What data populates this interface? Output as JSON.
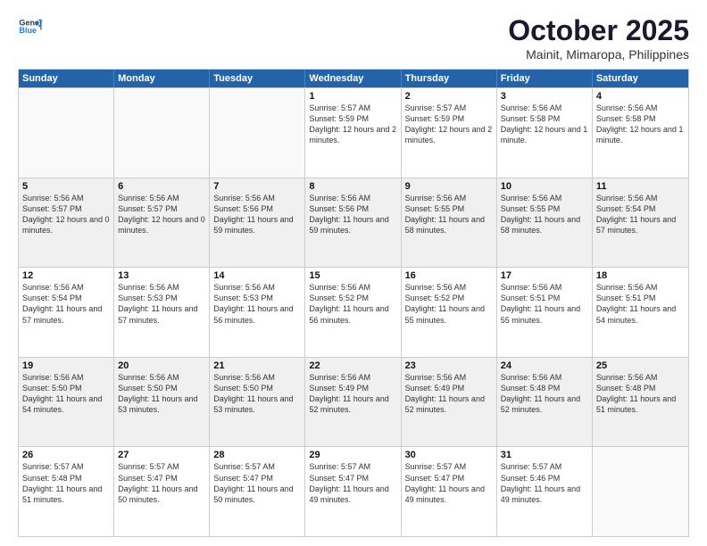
{
  "header": {
    "logo_line1": "General",
    "logo_line2": "Blue",
    "month": "October 2025",
    "location": "Mainit, Mimaropa, Philippines"
  },
  "weekdays": [
    "Sunday",
    "Monday",
    "Tuesday",
    "Wednesday",
    "Thursday",
    "Friday",
    "Saturday"
  ],
  "rows": [
    [
      {
        "day": "",
        "sunrise": "",
        "sunset": "",
        "daylight": "",
        "empty": true
      },
      {
        "day": "",
        "sunrise": "",
        "sunset": "",
        "daylight": "",
        "empty": true
      },
      {
        "day": "",
        "sunrise": "",
        "sunset": "",
        "daylight": "",
        "empty": true
      },
      {
        "day": "1",
        "sunrise": "Sunrise: 5:57 AM",
        "sunset": "Sunset: 5:59 PM",
        "daylight": "Daylight: 12 hours and 2 minutes."
      },
      {
        "day": "2",
        "sunrise": "Sunrise: 5:57 AM",
        "sunset": "Sunset: 5:59 PM",
        "daylight": "Daylight: 12 hours and 2 minutes."
      },
      {
        "day": "3",
        "sunrise": "Sunrise: 5:56 AM",
        "sunset": "Sunset: 5:58 PM",
        "daylight": "Daylight: 12 hours and 1 minute."
      },
      {
        "day": "4",
        "sunrise": "Sunrise: 5:56 AM",
        "sunset": "Sunset: 5:58 PM",
        "daylight": "Daylight: 12 hours and 1 minute."
      }
    ],
    [
      {
        "day": "5",
        "sunrise": "Sunrise: 5:56 AM",
        "sunset": "Sunset: 5:57 PM",
        "daylight": "Daylight: 12 hours and 0 minutes."
      },
      {
        "day": "6",
        "sunrise": "Sunrise: 5:56 AM",
        "sunset": "Sunset: 5:57 PM",
        "daylight": "Daylight: 12 hours and 0 minutes."
      },
      {
        "day": "7",
        "sunrise": "Sunrise: 5:56 AM",
        "sunset": "Sunset: 5:56 PM",
        "daylight": "Daylight: 11 hours and 59 minutes."
      },
      {
        "day": "8",
        "sunrise": "Sunrise: 5:56 AM",
        "sunset": "Sunset: 5:56 PM",
        "daylight": "Daylight: 11 hours and 59 minutes."
      },
      {
        "day": "9",
        "sunrise": "Sunrise: 5:56 AM",
        "sunset": "Sunset: 5:55 PM",
        "daylight": "Daylight: 11 hours and 58 minutes."
      },
      {
        "day": "10",
        "sunrise": "Sunrise: 5:56 AM",
        "sunset": "Sunset: 5:55 PM",
        "daylight": "Daylight: 11 hours and 58 minutes."
      },
      {
        "day": "11",
        "sunrise": "Sunrise: 5:56 AM",
        "sunset": "Sunset: 5:54 PM",
        "daylight": "Daylight: 11 hours and 57 minutes."
      }
    ],
    [
      {
        "day": "12",
        "sunrise": "Sunrise: 5:56 AM",
        "sunset": "Sunset: 5:54 PM",
        "daylight": "Daylight: 11 hours and 57 minutes."
      },
      {
        "day": "13",
        "sunrise": "Sunrise: 5:56 AM",
        "sunset": "Sunset: 5:53 PM",
        "daylight": "Daylight: 11 hours and 57 minutes."
      },
      {
        "day": "14",
        "sunrise": "Sunrise: 5:56 AM",
        "sunset": "Sunset: 5:53 PM",
        "daylight": "Daylight: 11 hours and 56 minutes."
      },
      {
        "day": "15",
        "sunrise": "Sunrise: 5:56 AM",
        "sunset": "Sunset: 5:52 PM",
        "daylight": "Daylight: 11 hours and 56 minutes."
      },
      {
        "day": "16",
        "sunrise": "Sunrise: 5:56 AM",
        "sunset": "Sunset: 5:52 PM",
        "daylight": "Daylight: 11 hours and 55 minutes."
      },
      {
        "day": "17",
        "sunrise": "Sunrise: 5:56 AM",
        "sunset": "Sunset: 5:51 PM",
        "daylight": "Daylight: 11 hours and 55 minutes."
      },
      {
        "day": "18",
        "sunrise": "Sunrise: 5:56 AM",
        "sunset": "Sunset: 5:51 PM",
        "daylight": "Daylight: 11 hours and 54 minutes."
      }
    ],
    [
      {
        "day": "19",
        "sunrise": "Sunrise: 5:56 AM",
        "sunset": "Sunset: 5:50 PM",
        "daylight": "Daylight: 11 hours and 54 minutes."
      },
      {
        "day": "20",
        "sunrise": "Sunrise: 5:56 AM",
        "sunset": "Sunset: 5:50 PM",
        "daylight": "Daylight: 11 hours and 53 minutes."
      },
      {
        "day": "21",
        "sunrise": "Sunrise: 5:56 AM",
        "sunset": "Sunset: 5:50 PM",
        "daylight": "Daylight: 11 hours and 53 minutes."
      },
      {
        "day": "22",
        "sunrise": "Sunrise: 5:56 AM",
        "sunset": "Sunset: 5:49 PM",
        "daylight": "Daylight: 11 hours and 52 minutes."
      },
      {
        "day": "23",
        "sunrise": "Sunrise: 5:56 AM",
        "sunset": "Sunset: 5:49 PM",
        "daylight": "Daylight: 11 hours and 52 minutes."
      },
      {
        "day": "24",
        "sunrise": "Sunrise: 5:56 AM",
        "sunset": "Sunset: 5:48 PM",
        "daylight": "Daylight: 11 hours and 52 minutes."
      },
      {
        "day": "25",
        "sunrise": "Sunrise: 5:56 AM",
        "sunset": "Sunset: 5:48 PM",
        "daylight": "Daylight: 11 hours and 51 minutes."
      }
    ],
    [
      {
        "day": "26",
        "sunrise": "Sunrise: 5:57 AM",
        "sunset": "Sunset: 5:48 PM",
        "daylight": "Daylight: 11 hours and 51 minutes."
      },
      {
        "day": "27",
        "sunrise": "Sunrise: 5:57 AM",
        "sunset": "Sunset: 5:47 PM",
        "daylight": "Daylight: 11 hours and 50 minutes."
      },
      {
        "day": "28",
        "sunrise": "Sunrise: 5:57 AM",
        "sunset": "Sunset: 5:47 PM",
        "daylight": "Daylight: 11 hours and 50 minutes."
      },
      {
        "day": "29",
        "sunrise": "Sunrise: 5:57 AM",
        "sunset": "Sunset: 5:47 PM",
        "daylight": "Daylight: 11 hours and 49 minutes."
      },
      {
        "day": "30",
        "sunrise": "Sunrise: 5:57 AM",
        "sunset": "Sunset: 5:47 PM",
        "daylight": "Daylight: 11 hours and 49 minutes."
      },
      {
        "day": "31",
        "sunrise": "Sunrise: 5:57 AM",
        "sunset": "Sunset: 5:46 PM",
        "daylight": "Daylight: 11 hours and 49 minutes."
      },
      {
        "day": "",
        "sunrise": "",
        "sunset": "",
        "daylight": "",
        "empty": true
      }
    ]
  ]
}
